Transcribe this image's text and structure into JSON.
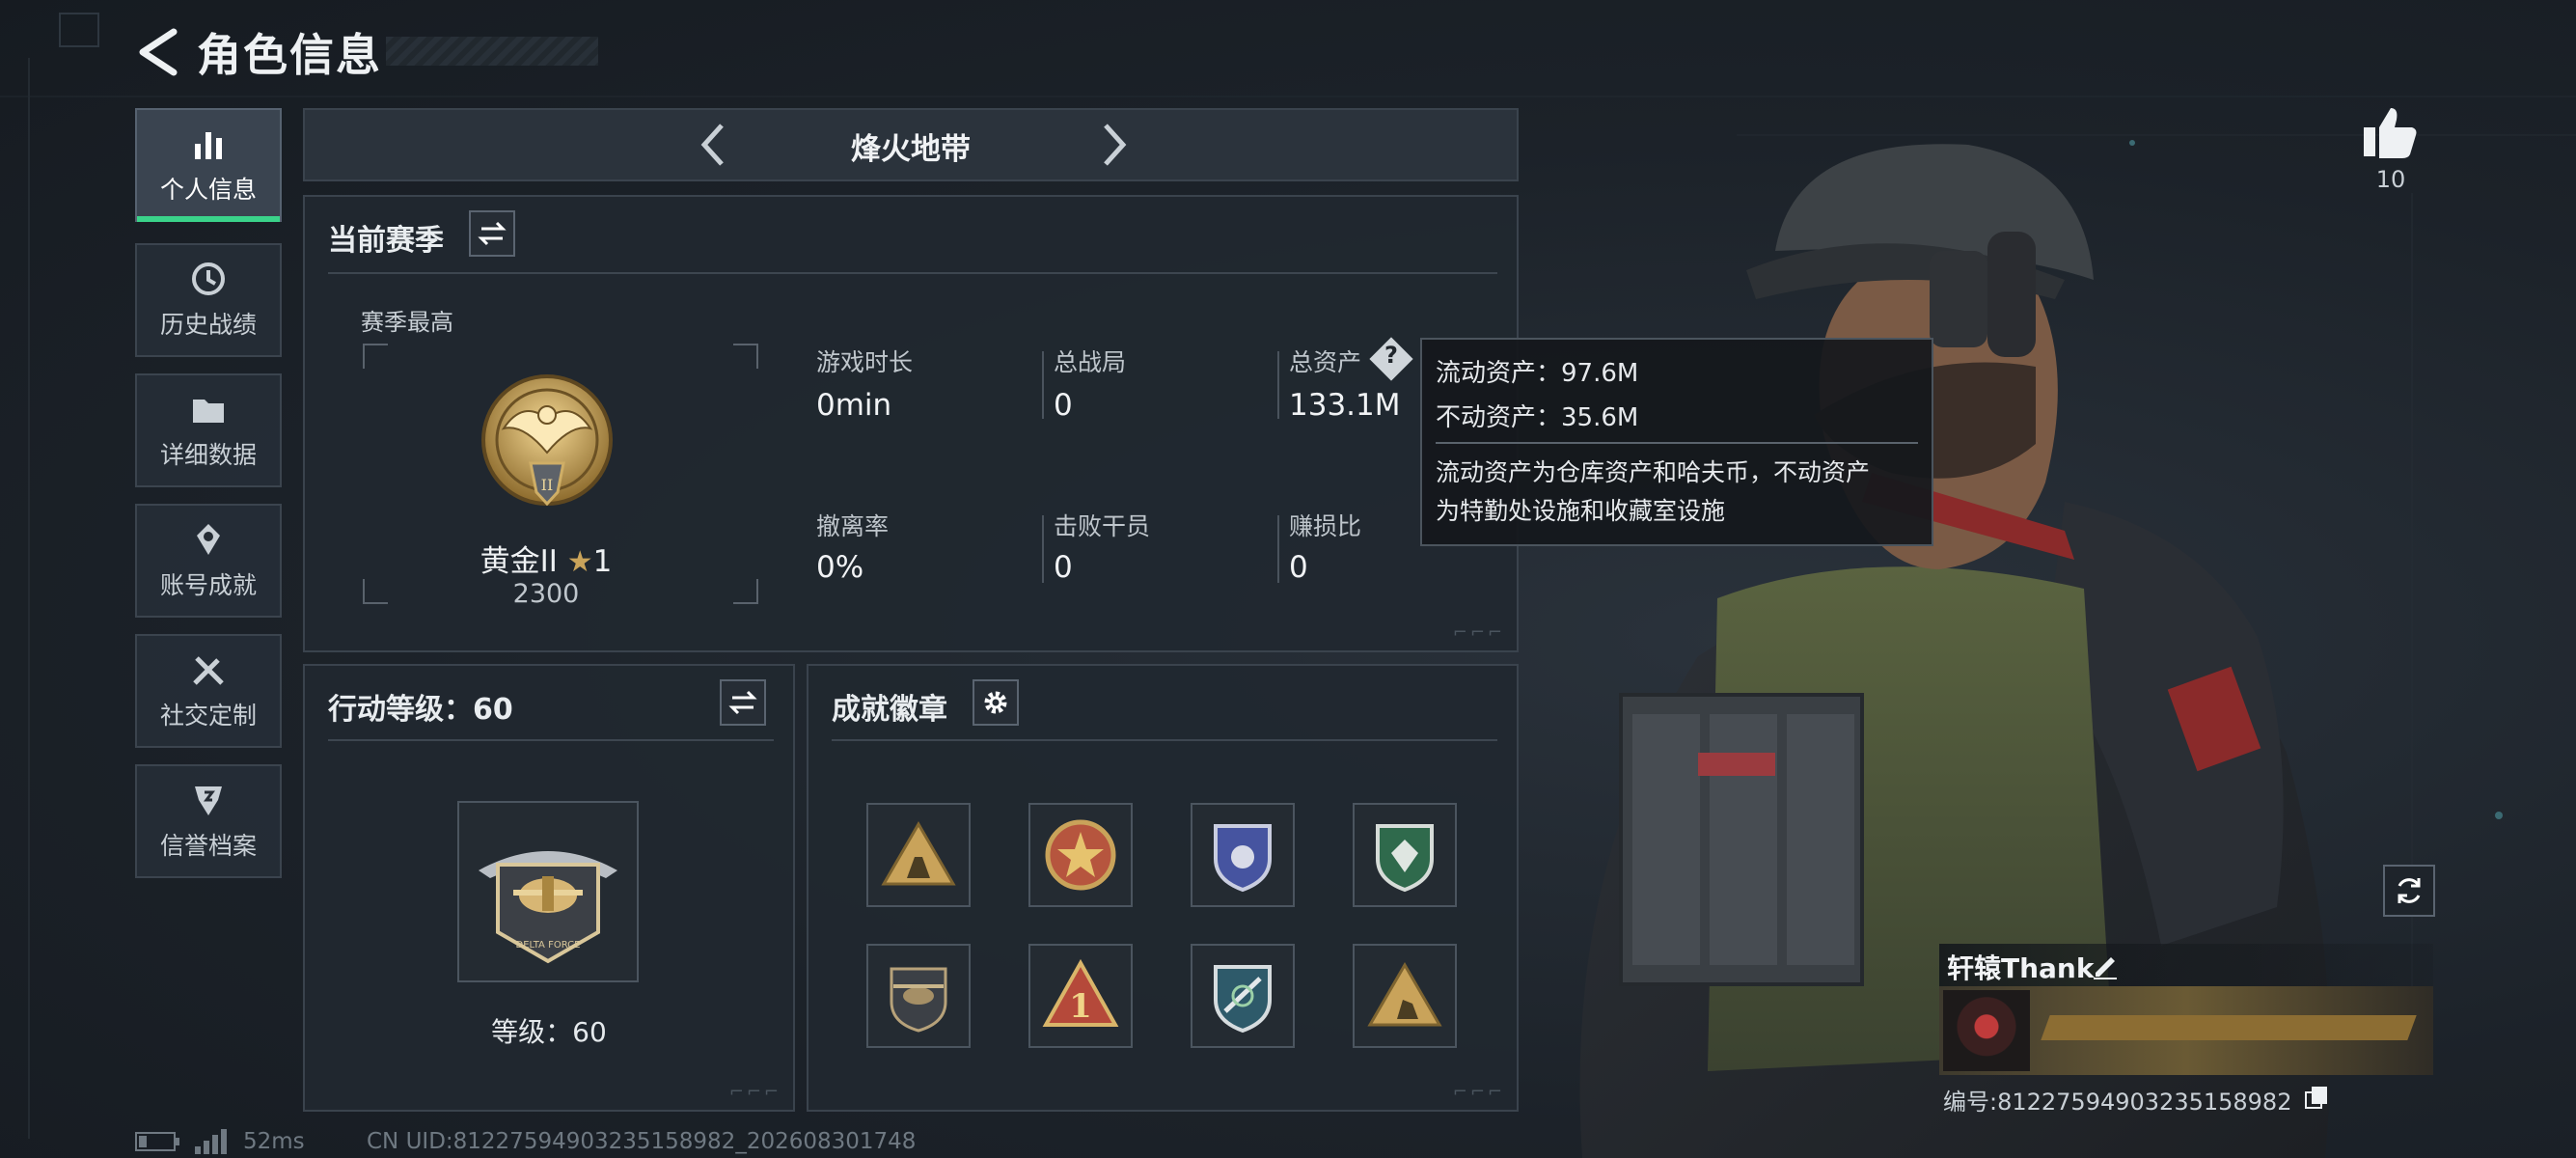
{
  "header": {
    "title": "角色信息"
  },
  "sidebar": {
    "items": [
      {
        "label": "个人信息",
        "icon": "bar-chart-icon",
        "active": true
      },
      {
        "label": "历史战绩",
        "icon": "history-icon",
        "active": false
      },
      {
        "label": "详细数据",
        "icon": "folder-icon",
        "active": false
      },
      {
        "label": "账号成就",
        "icon": "achievement-icon",
        "active": false
      },
      {
        "label": "社交定制",
        "icon": "tools-icon",
        "active": false
      },
      {
        "label": "信誉档案",
        "icon": "shield-credit-icon",
        "active": false
      }
    ]
  },
  "mode": {
    "title": "烽火地带"
  },
  "season": {
    "header": "当前赛季",
    "best_label": "赛季最高",
    "rank_name": "黄金II",
    "rank_stars": "1",
    "rank_score": "2300",
    "stats": [
      {
        "label": "游戏时长",
        "value": "0min"
      },
      {
        "label": "总战局",
        "value": "0"
      },
      {
        "label": "总资产",
        "value": "133.1M"
      },
      {
        "label": "撤离率",
        "value": "0%"
      },
      {
        "label": "击败干员",
        "value": "0"
      },
      {
        "label": "赚损比",
        "value": "0"
      }
    ]
  },
  "tooltip": {
    "liquid": "流动资产：97.6M",
    "fixed": "不动资产：35.6M",
    "desc_line1": "流动资产为仓库资产和哈夫币，不动资产",
    "desc_line2": "为特勤处设施和收藏室设施"
  },
  "action_level": {
    "header": "行动等级：60",
    "level_text": "等级：60"
  },
  "achievements": {
    "header": "成就徽章",
    "badges": [
      "triangle-soldiers-badge",
      "star-emblem-badge",
      "blue-shield-badge",
      "green-shield-badge",
      "helicopter-badge",
      "number-one-badge",
      "crossed-shield-badge",
      "kneeling-soldier-badge"
    ]
  },
  "profile": {
    "likes": "10",
    "player_name": "轩辕Thank",
    "id_text": "编号:81227594903235158982"
  },
  "status": {
    "ping": "52ms",
    "uid": "CN UID:81227594903235158982_202608301748"
  },
  "colors": {
    "accent_green": "#3ad38a",
    "gold": "#c9a35a"
  }
}
